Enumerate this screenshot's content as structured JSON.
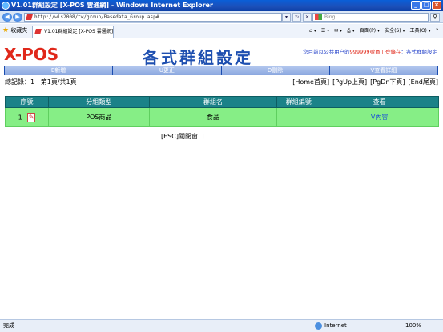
{
  "window": {
    "title": "V1.01群組設定 [X-POS 雲通網] - Windows Internet Explorer"
  },
  "browser": {
    "address": "http://wis2008/tw/group/Basedata_Group.asp#",
    "search_placeholder": "Bing",
    "favorites_label": "收藏夾",
    "tab_title": "V1.01群組設定 [X-POS 雲通網]",
    "commands": [
      "頁面(P) ▾",
      "安全(S) ▾",
      "工具(O) ▾",
      "?"
    ]
  },
  "page": {
    "logo": "X-POS",
    "title": "各式群組設定",
    "notice_prefix": "您目前以公共用户的",
    "notice_user": "999999號員工登錄在",
    "notice_suffix": "：各式群組設定"
  },
  "toolbar": {
    "buttons": [
      "E新增",
      "U更正",
      "D刪除",
      "V查看詳細"
    ]
  },
  "stats": {
    "total_records": "總記錄：1",
    "page_info": "第1頁/共1頁"
  },
  "pager": {
    "home": "[Home首頁]",
    "pgup": "[PgUp上頁]",
    "pgdn": "[PgDn下頁]",
    "end": "[End尾頁]"
  },
  "table": {
    "headers": [
      "序號",
      "分組類型",
      "群組名",
      "群組編號",
      "查看"
    ],
    "rows": [
      {
        "index": "1",
        "type": "POS商品",
        "name": "食品",
        "code": "",
        "view": "V內容"
      }
    ]
  },
  "close_button": "[ESC]關閉窗口",
  "statusbar": {
    "status": "完成",
    "zone": "Internet",
    "zoom": "100%"
  }
}
